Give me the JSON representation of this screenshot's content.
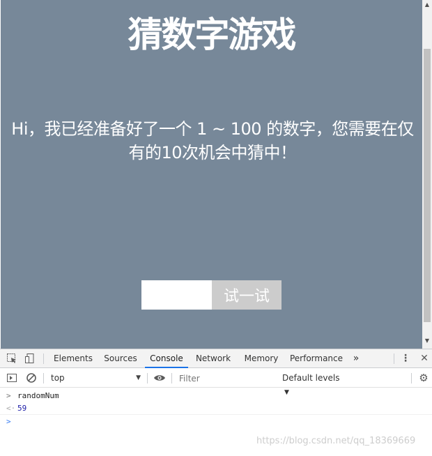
{
  "page": {
    "title": "猜数字游戏",
    "intro": "Hi，我已经准备好了一个 1 ~ 100 的数字，您需要在仅有的10次机会中猜中！",
    "input_value": "",
    "button_label": "试一试",
    "background_color": "#778899"
  },
  "devtools": {
    "tabs": [
      "Elements",
      "Sources",
      "Console",
      "Network",
      "Memory",
      "Performance"
    ],
    "active_tab": "Console",
    "more_icon": "»",
    "context": "top",
    "filter_placeholder": "Filter",
    "levels": "Default levels",
    "console_lines": [
      {
        "type": "input",
        "prefix": ">",
        "text": "randomNum"
      },
      {
        "type": "result",
        "prefix": "<·",
        "text": "59"
      },
      {
        "type": "prompt",
        "prefix": ">",
        "text": ""
      }
    ]
  },
  "watermark": "https://blog.csdn.net/qq_18369669"
}
